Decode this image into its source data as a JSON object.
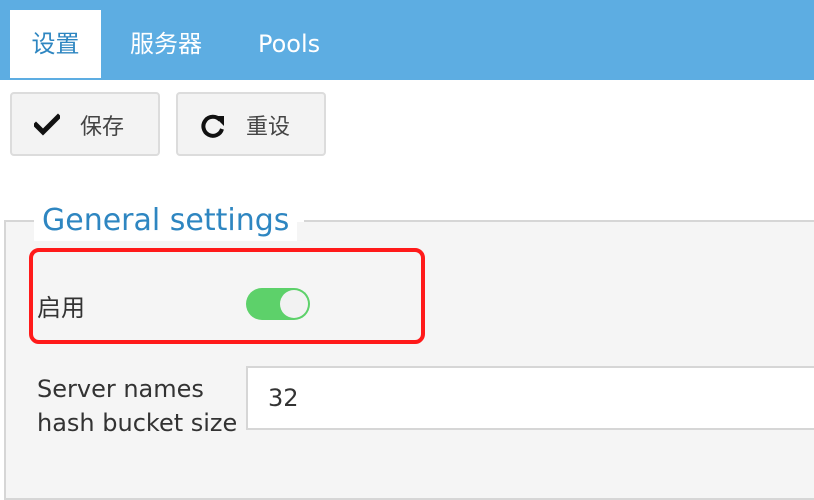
{
  "tabs": [
    {
      "label": "设置",
      "active": true
    },
    {
      "label": "服务器",
      "active": false
    },
    {
      "label": "Pools",
      "active": false
    }
  ],
  "toolbar": {
    "save_label": "保存",
    "save_icon": "check-icon",
    "reset_label": "重设",
    "reset_icon": "refresh-icon"
  },
  "section": {
    "legend": "General settings"
  },
  "settings": {
    "enable": {
      "label": "启用",
      "value": true
    },
    "hash_bucket": {
      "label_line1": "Server names",
      "label_line2": "hash bucket size",
      "value": "32"
    }
  },
  "colors": {
    "tabbar": "#5dade2",
    "accent": "#2e86c1",
    "toggle_on": "#5dd16a",
    "highlight": "#ff1a1a"
  }
}
